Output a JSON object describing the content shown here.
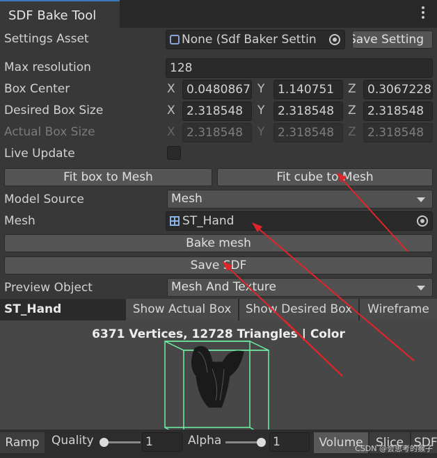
{
  "window": {
    "tab_title": "SDF Bake Tool"
  },
  "settings": {
    "settings_asset_label": "Settings Asset",
    "settings_asset_value": "None (Sdf Baker Settin",
    "save_setting_label": "Save Setting",
    "max_resolution_label": "Max resolution",
    "max_resolution_value": "128",
    "box_center_label": "Box Center",
    "box_center": {
      "x": "0.0480867",
      "y": "1.140751",
      "z": "0.3067228"
    },
    "desired_box_size_label": "Desired Box Size",
    "desired_box_size": {
      "x": "2.318548",
      "y": "2.318548",
      "z": "2.318548"
    },
    "actual_box_size_label": "Actual Box Size",
    "actual_box_size": {
      "x": "2.318548",
      "y": "2.318548",
      "z": "2.318548"
    },
    "live_update_label": "Live Update",
    "axis_x": "X",
    "axis_y": "Y",
    "axis_z": "Z"
  },
  "buttons": {
    "fit_box": "Fit box to Mesh",
    "fit_cube": "Fit cube to Mesh",
    "bake_mesh": "Bake mesh",
    "save_sdf": "Save SDF"
  },
  "model": {
    "model_source_label": "Model Source",
    "model_source_value": "Mesh",
    "mesh_label": "Mesh",
    "mesh_value": "ST_Hand",
    "preview_object_label": "Preview Object",
    "preview_object_value": "Mesh And Texture"
  },
  "preview": {
    "title": "ST_Hand",
    "tabs": [
      "Show Actual Box",
      "Show Desired Box",
      "Wireframe"
    ],
    "info": "6371 Vertices, 12728 Triangles | Color"
  },
  "bottom": {
    "ramp_label": "Ramp",
    "quality_label": "Quality",
    "quality_value": "1",
    "alpha_label": "Alpha",
    "alpha_value": "1",
    "modes": [
      "Volume",
      "Slice",
      "SDF"
    ],
    "quality_slider": 0.0,
    "alpha_slider": 1.0
  },
  "watermark": "CSDN @会思考的猴子",
  "colors": {
    "accent_tab": "#3a79bb",
    "annotation_arrow": "#e0242a",
    "wire_box": "#6ef0a0"
  }
}
